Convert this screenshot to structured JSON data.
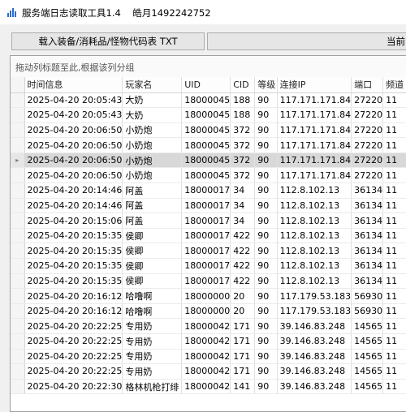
{
  "window": {
    "title": "服务端日志读取工具1.4",
    "author": "皓月1492242752"
  },
  "toolbar": {
    "load_label": "载入装备/消耗品/怪物代码表 TXT",
    "current_label": "当前"
  },
  "grid": {
    "group_hint": "拖动列标题至此,根据该列分组",
    "columns": [
      "时间信息",
      "玩家名",
      "UID",
      "CID",
      "等级",
      "连接IP",
      "端口",
      "频道"
    ],
    "rows": [
      {
        "time": "2025-04-20 20:05:43",
        "name": "大奶",
        "uid": "18000045",
        "cid": "188",
        "level": "90",
        "ip": "117.171.171.84",
        "port": "27220",
        "ch": "11"
      },
      {
        "time": "2025-04-20 20:05:43",
        "name": "大奶",
        "uid": "18000045",
        "cid": "188",
        "level": "90",
        "ip": "117.171.171.84",
        "port": "27220",
        "ch": "11"
      },
      {
        "time": "2025-04-20 20:06:50",
        "name": "小奶炮",
        "uid": "18000045",
        "cid": "372",
        "level": "90",
        "ip": "117.171.171.84",
        "port": "27220",
        "ch": "11"
      },
      {
        "time": "2025-04-20 20:06:50",
        "name": "小奶炮",
        "uid": "18000045",
        "cid": "372",
        "level": "90",
        "ip": "117.171.171.84",
        "port": "27220",
        "ch": "11"
      },
      {
        "time": "2025-04-20 20:06:50",
        "name": "小奶炮",
        "uid": "18000045",
        "cid": "372",
        "level": "90",
        "ip": "117.171.171.84",
        "port": "27220",
        "ch": "11",
        "selected": true
      },
      {
        "time": "2025-04-20 20:06:50",
        "name": "小奶炮",
        "uid": "18000045",
        "cid": "372",
        "level": "90",
        "ip": "117.171.171.84",
        "port": "27220",
        "ch": "11"
      },
      {
        "time": "2025-04-20 20:14:46",
        "name": "阿盖",
        "uid": "18000017",
        "cid": "34",
        "level": "90",
        "ip": "112.8.102.13",
        "port": "36134",
        "ch": "11"
      },
      {
        "time": "2025-04-20 20:14:46",
        "name": "阿盖",
        "uid": "18000017",
        "cid": "34",
        "level": "90",
        "ip": "112.8.102.13",
        "port": "36134",
        "ch": "11"
      },
      {
        "time": "2025-04-20 20:15:06",
        "name": "阿盖",
        "uid": "18000017",
        "cid": "34",
        "level": "90",
        "ip": "112.8.102.13",
        "port": "36134",
        "ch": "11"
      },
      {
        "time": "2025-04-20 20:15:35",
        "name": "侯卿",
        "uid": "18000017",
        "cid": "422",
        "level": "90",
        "ip": "112.8.102.13",
        "port": "36134",
        "ch": "11"
      },
      {
        "time": "2025-04-20 20:15:35",
        "name": "侯卿",
        "uid": "18000017",
        "cid": "422",
        "level": "90",
        "ip": "112.8.102.13",
        "port": "36134",
        "ch": "11"
      },
      {
        "time": "2025-04-20 20:15:35",
        "name": "侯卿",
        "uid": "18000017",
        "cid": "422",
        "level": "90",
        "ip": "112.8.102.13",
        "port": "36134",
        "ch": "11"
      },
      {
        "time": "2025-04-20 20:15:35",
        "name": "侯卿",
        "uid": "18000017",
        "cid": "422",
        "level": "90",
        "ip": "112.8.102.13",
        "port": "36134",
        "ch": "11"
      },
      {
        "time": "2025-04-20 20:16:12",
        "name": "哈噜啊",
        "uid": "18000000",
        "cid": "20",
        "level": "90",
        "ip": "117.179.53.183",
        "port": "56930",
        "ch": "11"
      },
      {
        "time": "2025-04-20 20:16:12",
        "name": "哈噜啊",
        "uid": "18000000",
        "cid": "20",
        "level": "90",
        "ip": "117.179.53.183",
        "port": "56930",
        "ch": "11"
      },
      {
        "time": "2025-04-20 20:22:25",
        "name": "专用奶",
        "uid": "18000042",
        "cid": "171",
        "level": "90",
        "ip": "39.146.83.248",
        "port": "14565",
        "ch": "11"
      },
      {
        "time": "2025-04-20 20:22:25",
        "name": "专用奶",
        "uid": "18000042",
        "cid": "171",
        "level": "90",
        "ip": "39.146.83.248",
        "port": "14565",
        "ch": "11"
      },
      {
        "time": "2025-04-20 20:22:25",
        "name": "专用奶",
        "uid": "18000042",
        "cid": "171",
        "level": "90",
        "ip": "39.146.83.248",
        "port": "14565",
        "ch": "11"
      },
      {
        "time": "2025-04-20 20:22:25",
        "name": "专用奶",
        "uid": "18000042",
        "cid": "171",
        "level": "90",
        "ip": "39.146.83.248",
        "port": "14565",
        "ch": "11"
      },
      {
        "time": "2025-04-20 20:22:30",
        "name": "格林机枪打绯",
        "uid": "18000042",
        "cid": "141",
        "level": "90",
        "ip": "39.146.83.248",
        "port": "14565",
        "ch": "11"
      }
    ]
  }
}
